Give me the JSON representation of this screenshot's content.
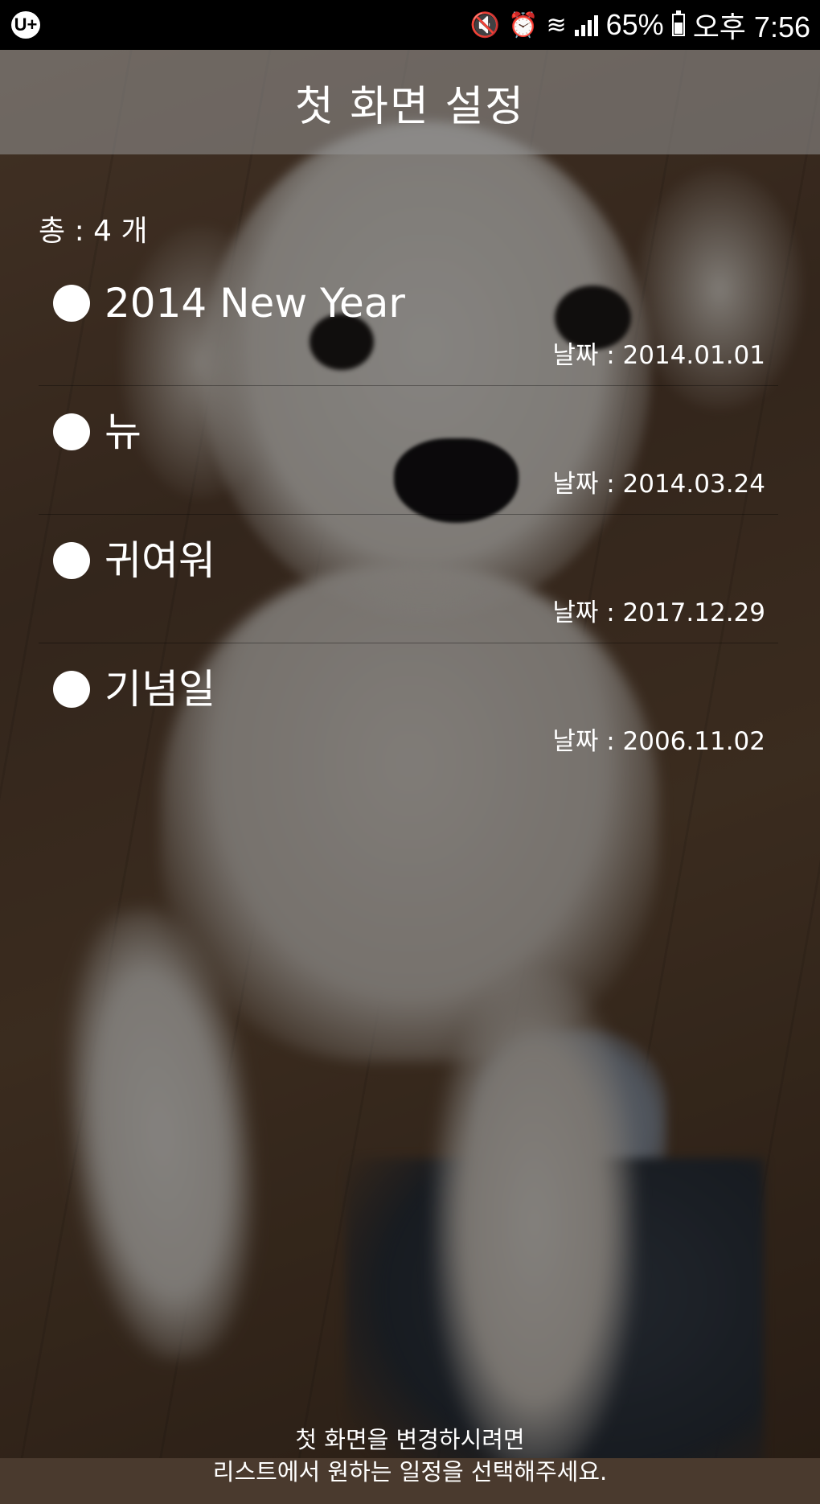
{
  "status_bar": {
    "app_icon": "U+",
    "battery": "65%",
    "time": "오후 7:56",
    "icons": [
      "mute-icon",
      "alarm-icon",
      "wifi-icon",
      "signal-icon",
      "battery-icon"
    ]
  },
  "header": {
    "title": "첫 화면 설정"
  },
  "summary": {
    "count_label": "총 : 4 개"
  },
  "events": [
    {
      "name": "2014 New Year",
      "date": "날짜 : 2014.01.01"
    },
    {
      "name": "뉴",
      "date": "날짜 : 2014.03.24"
    },
    {
      "name": "귀여워",
      "date": "날짜 : 2017.12.29"
    },
    {
      "name": "기념일",
      "date": "날짜 : 2006.11.02"
    }
  ],
  "footer": {
    "line1": "첫 화면을 변경하시려면",
    "line2": "리스트에서 원하는 일정을 선택해주세요."
  }
}
